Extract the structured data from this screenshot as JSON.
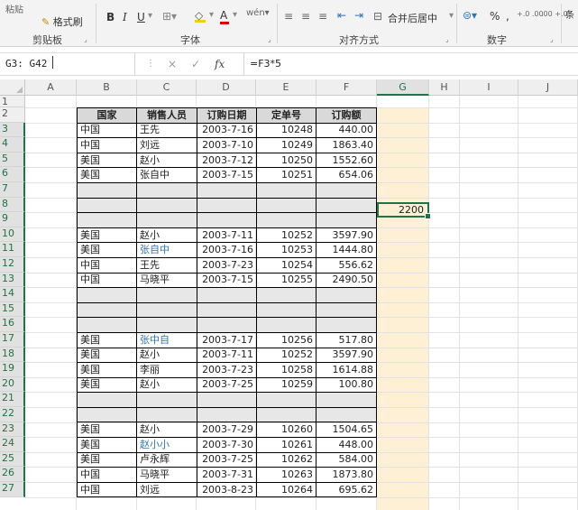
{
  "ribbon": {
    "paste_label": "粘贴",
    "format_painter": "格式刷",
    "clipboard_group": "剪贴板",
    "font_group": "字体",
    "alignment_group": "对齐方式",
    "merge_center": "合并后居中",
    "number_group": "数字",
    "percent": "%",
    "comma": ",",
    "inc_decimal": "+.0 .00",
    "dec_decimal": ".00 +.0",
    "bold": "B",
    "italic": "I",
    "underline": "U",
    "font_color": "A",
    "styles_label": "条"
  },
  "formula_bar": {
    "name_box": "G3: G42",
    "cancel": "×",
    "enter": "✓",
    "fx": "fx",
    "formula": "=F3*5"
  },
  "columns": [
    "A",
    "B",
    "C",
    "D",
    "E",
    "F",
    "G",
    "H",
    "I",
    "J"
  ],
  "rows": [
    "1",
    "2",
    "3",
    "4",
    "5",
    "6",
    "7",
    "8",
    "9",
    "10",
    "11",
    "12",
    "13",
    "14",
    "15",
    "16",
    "17",
    "18",
    "19",
    "20",
    "21",
    "22",
    "23",
    "24",
    "25",
    "26",
    "27"
  ],
  "table": {
    "headers": [
      "国家",
      "销售人员",
      "订购日期",
      "定单号",
      "订购额"
    ],
    "rows": [
      {
        "cells": [
          "中国",
          "王先",
          "2003-7-16",
          "10248",
          "440.00"
        ]
      },
      {
        "cells": [
          "中国",
          "刘远",
          "2003-7-10",
          "10249",
          "1863.40"
        ]
      },
      {
        "cells": [
          "美国",
          "赵小",
          "2003-7-12",
          "10250",
          "1552.60"
        ]
      },
      {
        "cells": [
          "美国",
          "张自中",
          "2003-7-15",
          "10251",
          "654.06"
        ]
      },
      {
        "blank": true
      },
      {
        "blank": true
      },
      {
        "blank": true
      },
      {
        "cells": [
          "美国",
          "赵小",
          "2003-7-11",
          "10252",
          "3597.90"
        ]
      },
      {
        "cells": [
          "美国",
          "张自中",
          "2003-7-16",
          "10253",
          "1444.80"
        ],
        "hl": true
      },
      {
        "cells": [
          "中国",
          "王先",
          "2003-7-23",
          "10254",
          "556.62"
        ]
      },
      {
        "cells": [
          "中国",
          "马晓平",
          "2003-7-15",
          "10255",
          "2490.50"
        ]
      },
      {
        "blank": true
      },
      {
        "blank": true
      },
      {
        "blank": true
      },
      {
        "cells": [
          "美国",
          "张中自",
          "2003-7-17",
          "10256",
          "517.80"
        ],
        "hl": true
      },
      {
        "cells": [
          "美国",
          "赵小",
          "2003-7-11",
          "10252",
          "3597.90"
        ]
      },
      {
        "cells": [
          "美国",
          "李丽",
          "2003-7-23",
          "10258",
          "1614.88"
        ]
      },
      {
        "cells": [
          "美国",
          "赵小",
          "2003-7-25",
          "10259",
          "100.80"
        ]
      },
      {
        "blank": true
      },
      {
        "blank": true
      },
      {
        "cells": [
          "美国",
          "赵小",
          "2003-7-29",
          "10260",
          "1504.65"
        ]
      },
      {
        "cells": [
          "美国",
          "赵小小",
          "2003-7-30",
          "10261",
          "448.00"
        ],
        "hl": true
      },
      {
        "cells": [
          "美国",
          "卢永辉",
          "2003-7-25",
          "10262",
          "584.00"
        ]
      },
      {
        "cells": [
          "中国",
          "马晓平",
          "2003-7-31",
          "10263",
          "1873.80"
        ]
      },
      {
        "cells": [
          "中国",
          "刘远",
          "2003-8-23",
          "10264",
          "695.62"
        ]
      }
    ]
  },
  "active_cell": {
    "address": "G3",
    "value": "2200"
  }
}
